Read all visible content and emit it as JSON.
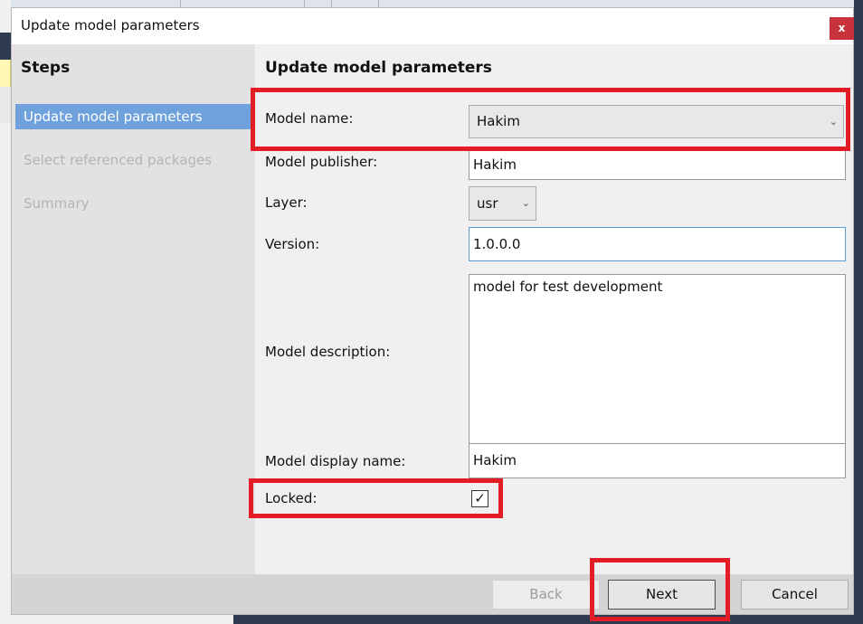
{
  "dialog": {
    "title": "Update model parameters",
    "close_glyph": "x"
  },
  "steps": {
    "title": "Steps",
    "items": [
      {
        "label": "Update model parameters",
        "state": "active"
      },
      {
        "label": "Select referenced packages",
        "state": "disabled"
      },
      {
        "label": "Summary",
        "state": "disabled"
      }
    ]
  },
  "form": {
    "title": "Update model parameters",
    "model_name": {
      "label": "Model name:",
      "value": "Hakim"
    },
    "model_publisher": {
      "label": "Model publisher:",
      "value": "Hakim"
    },
    "layer": {
      "label": "Layer:",
      "value": "usr"
    },
    "version": {
      "label": "Version:",
      "value": "1.0.0.0"
    },
    "model_description": {
      "label": "Model description:",
      "value": "model for test development"
    },
    "model_display_name": {
      "label": "Model display name:",
      "value": "Hakim"
    },
    "locked": {
      "label": "Locked:",
      "checked": true,
      "check_glyph": "✓"
    }
  },
  "buttons": {
    "back": "Back",
    "next": "Next",
    "cancel": "Cancel"
  },
  "colors": {
    "accent": "#6fa2dc",
    "highlight": "#e21d26",
    "close": "#c8323a"
  }
}
